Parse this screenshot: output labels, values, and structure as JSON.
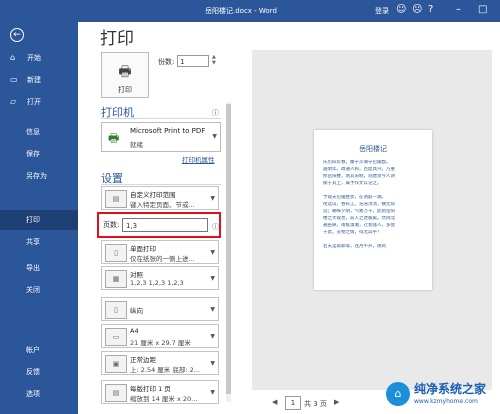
{
  "titlebar": {
    "title": "岳阳楼记.docx - Word",
    "signin": "登录",
    "icons": [
      "smile-icon",
      "frown-icon",
      "help-icon",
      "minimize-icon",
      "maximize-icon"
    ]
  },
  "sidebar": {
    "items": [
      {
        "label": "开始",
        "icon": "home-icon"
      },
      {
        "label": "新建",
        "icon": "new-document-icon"
      },
      {
        "label": "打开",
        "icon": "folder-open-icon"
      },
      {
        "label": "信息"
      },
      {
        "label": "保存"
      },
      {
        "label": "另存为"
      },
      {
        "label": "打印",
        "active": true
      },
      {
        "label": "共享"
      },
      {
        "label": "导出"
      },
      {
        "label": "关闭"
      },
      {
        "label": "帐户"
      },
      {
        "label": "反馈"
      },
      {
        "label": "选项"
      }
    ]
  },
  "main": {
    "heading": "打印",
    "print_button": "打印",
    "copies_label": "份数:",
    "copies_value": "1",
    "printer_section": "打印机",
    "printer_name": "Microsoft Print to PDF",
    "printer_status": "就绪",
    "printer_props_link": "打印机属性",
    "settings_section": "设置",
    "options": [
      {
        "line1": "自定义打印范围",
        "line2": "键入特定页面、节或..."
      },
      {
        "line1": "单面打印",
        "line2": "仅在纸张的一侧上进..."
      },
      {
        "line1": "对照",
        "line2": "1,2,3    1,2,3    1,2,3"
      },
      {
        "line1": "纵向",
        "line2": ""
      },
      {
        "line1": "A4",
        "line2": "21 厘米 x 29.7 厘米"
      },
      {
        "line1": "正常边距",
        "line2": "上: 2.54 厘米 底部: 2..."
      },
      {
        "line1": "每版打印 1 页",
        "line2": "缩放到 14 厘米 x 20..."
      }
    ],
    "pages_label": "页数:",
    "pages_value": "1,3"
  },
  "preview": {
    "page_title": "岳阳楼记",
    "lines": [
      "庆历四年春，滕子京谪守巴陵郡。",
      "越明年，政通人和，百废具兴，乃重",
      "修岳阳楼，增其旧制，刻唐贤今人诗",
      "赋于其上，属予作文以记之。",
      "",
      "予观夫巴陵胜状，在洞庭一湖。",
      "衔远山，吞长江，浩浩汤汤，横无际",
      "涯；朝晖夕阴，气象万千。此则岳阳",
      "楼之大观也，前人之述备矣。然则北",
      "通巫峡，南极潇湘，迁客骚人，多会",
      "于此，览物之情，得无异乎？",
      "",
      "若夫淫雨霏霏，连月不开，阴风"
    ],
    "current_page": "1",
    "total_pages": "共 3 页"
  },
  "watermark": {
    "title": "纯净系统之家",
    "url": "www.kzmyhome.com"
  }
}
